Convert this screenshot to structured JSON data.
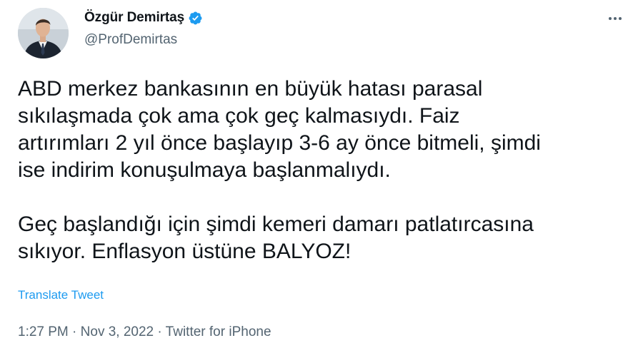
{
  "author": {
    "name": "Özgür Demirtaş",
    "handle": "@ProfDemirtas",
    "verified": true,
    "avatar_icon": "profile-photo"
  },
  "more_icon": "more-horizontal-icon",
  "tweet": {
    "text": "ABD merkez bankasının en büyük hatası parasal\nsıkılaşmada çok ama çok geç kalmasıydı. Faiz\nartırımları 2 yıl önce başlayıp 3-6 ay önce bitmeli, şimdi\nise indirim konuşulmaya başlanmalıydı.\n\nGeç başlandığı için şimdi kemeri damarı patlatırcasına\nsıkıyor. Enflasyon üstüne BALYOZ!",
    "translate_label": "Translate Tweet"
  },
  "meta": {
    "time": "1:27 PM",
    "separator": "·",
    "date": "Nov 3, 2022",
    "source": "Twitter for iPhone"
  },
  "colors": {
    "accent": "#1d9bf0",
    "text": "#0f1419",
    "secondary": "#536471"
  }
}
